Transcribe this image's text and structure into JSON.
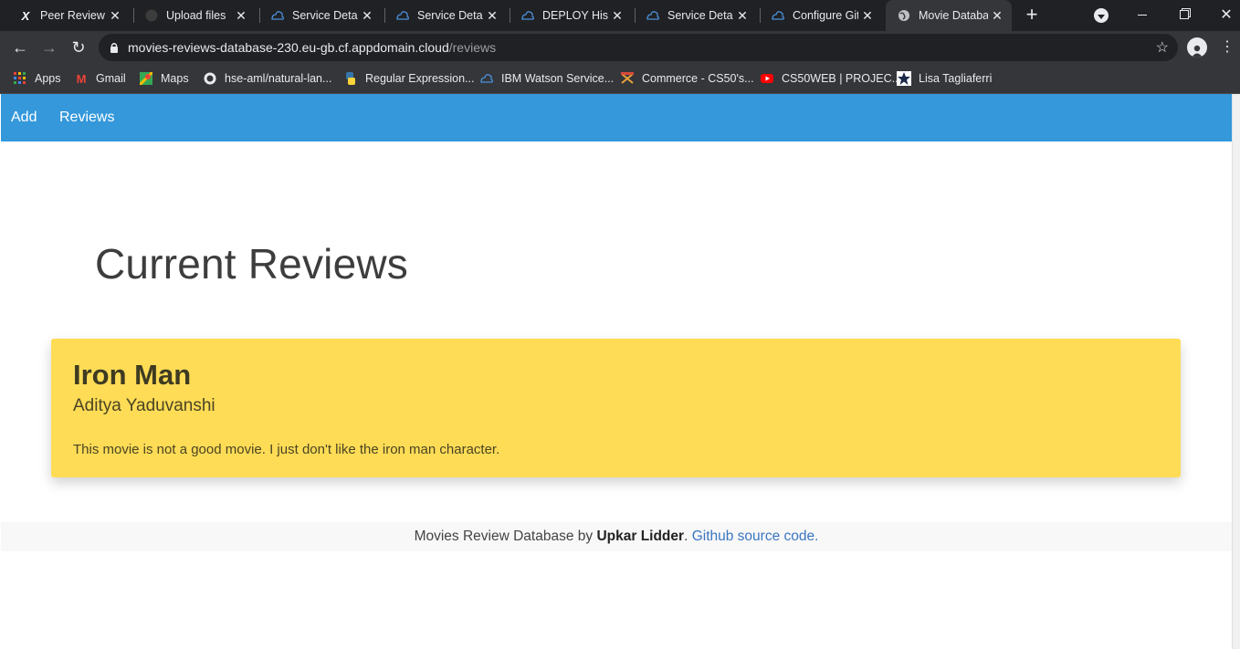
{
  "browser": {
    "tabs": [
      {
        "title": "Peer Review |",
        "icon": "x-logo-icon"
      },
      {
        "title": "Upload files",
        "icon": "github-icon"
      },
      {
        "title": "Service Detail",
        "icon": "ibm-cloud-icon"
      },
      {
        "title": "Service Detail",
        "icon": "ibm-cloud-icon"
      },
      {
        "title": "DEPLOY Histo",
        "icon": "ibm-cloud-icon"
      },
      {
        "title": "Service Detail",
        "icon": "ibm-cloud-icon"
      },
      {
        "title": "Configure Git",
        "icon": "ibm-cloud-icon"
      },
      {
        "title": "Movie Databa",
        "icon": "globe-icon"
      }
    ],
    "url": {
      "host": "movies-reviews-database-230.eu-gb.cf.appdomain.cloud",
      "path": "/reviews"
    },
    "bookmarks": [
      {
        "label": "Apps",
        "icon": "apps-grid-icon"
      },
      {
        "label": "Gmail",
        "icon": "gmail-icon"
      },
      {
        "label": "Maps",
        "icon": "maps-icon"
      },
      {
        "label": "hse-aml/natural-lan...",
        "icon": "github-icon"
      },
      {
        "label": "Regular Expression...",
        "icon": "python-icon"
      },
      {
        "label": "IBM Watson Service...",
        "icon": "ibm-cloud-icon"
      },
      {
        "label": "Commerce - CS50's...",
        "icon": "cs50-icon"
      },
      {
        "label": "CS50WEB | PROJEC...",
        "icon": "youtube-icon"
      },
      {
        "label": "Lisa Tagliaferri",
        "icon": "star-logo-icon"
      }
    ]
  },
  "page": {
    "nav": {
      "add": "Add",
      "reviews": "Reviews"
    },
    "heading": "Current Reviews",
    "review": {
      "title": "Iron Man",
      "author": "Aditya Yaduvanshi",
      "text": "This movie is not a good movie. I just don't like the iron man character."
    },
    "footer": {
      "prefix": "Movies Review Database by ",
      "author": "Upkar Lidder",
      "dot": ". ",
      "link": "Github source code."
    }
  },
  "colors": {
    "navbar": "#3498db",
    "card": "#fedc56",
    "link": "#3a76c0"
  }
}
